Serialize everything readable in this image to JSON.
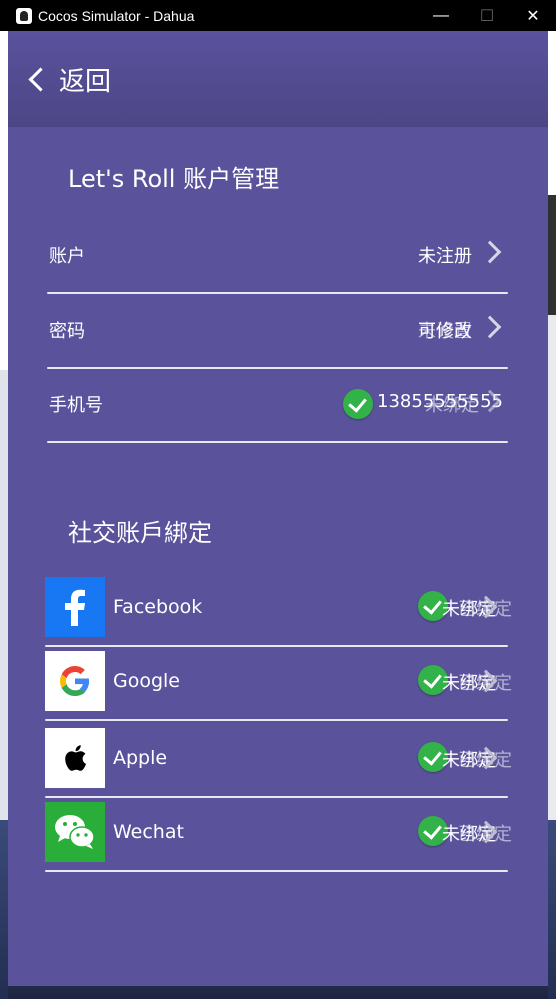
{
  "window": {
    "title": "Cocos Simulator - Dahua",
    "minimize": "—",
    "maximize": "☐",
    "close": "✕"
  },
  "header": {
    "back_label": "返回"
  },
  "account_section": {
    "title": "Let's Roll 账户管理",
    "rows": [
      {
        "label": "账户",
        "value": "未注册"
      },
      {
        "label": "密码",
        "value_a": "可修改",
        "value_b": "未设置"
      },
      {
        "label": "手机号",
        "value_a": "13855555555",
        "value_b": "未绑定"
      }
    ]
  },
  "social_section": {
    "title": "社交账戶綁定",
    "items": [
      {
        "name": "Facebook",
        "status_a": "未绑定",
        "status_b": "已绑定"
      },
      {
        "name": "Google",
        "status_a": "未绑定",
        "status_b": "已绑定"
      },
      {
        "name": "Apple",
        "status_a": "未绑定",
        "status_b": "已绑定"
      },
      {
        "name": "Wechat",
        "status_a": "未绑定",
        "status_b": "已绑定"
      }
    ]
  },
  "colors": {
    "background": "#5a539b",
    "header": "#4d4686",
    "check_green": "#33b24a",
    "facebook_blue": "#1877f2",
    "wechat_green": "#2aae3a"
  }
}
